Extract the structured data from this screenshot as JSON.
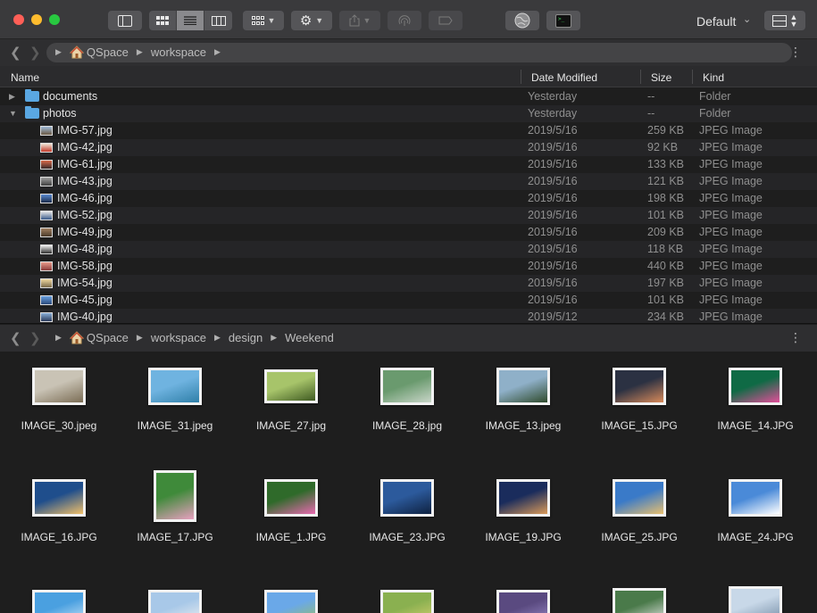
{
  "toolbar": {
    "profile": "Default"
  },
  "top_path": {
    "crumbs": [
      "QSpace",
      "workspace"
    ]
  },
  "columns": {
    "name": "Name",
    "date": "Date Modified",
    "size": "Size",
    "kind": "Kind"
  },
  "rows": [
    {
      "name": "documents",
      "date": "Yesterday",
      "size": "--",
      "kind": "Folder"
    },
    {
      "name": "photos",
      "date": "Yesterday",
      "size": "--",
      "kind": "Folder"
    },
    {
      "name": "IMG-57.jpg",
      "date": "2019/5/16",
      "size": "259 KB",
      "kind": "JPEG Image"
    },
    {
      "name": "IMG-42.jpg",
      "date": "2019/5/16",
      "size": "92 KB",
      "kind": "JPEG Image"
    },
    {
      "name": "IMG-61.jpg",
      "date": "2019/5/16",
      "size": "133 KB",
      "kind": "JPEG Image"
    },
    {
      "name": "IMG-43.jpg",
      "date": "2019/5/16",
      "size": "121 KB",
      "kind": "JPEG Image"
    },
    {
      "name": "IMG-46.jpg",
      "date": "2019/5/16",
      "size": "198 KB",
      "kind": "JPEG Image"
    },
    {
      "name": "IMG-52.jpg",
      "date": "2019/5/16",
      "size": "101 KB",
      "kind": "JPEG Image"
    },
    {
      "name": "IMG-49.jpg",
      "date": "2019/5/16",
      "size": "209 KB",
      "kind": "JPEG Image"
    },
    {
      "name": "IMG-48.jpg",
      "date": "2019/5/16",
      "size": "118 KB",
      "kind": "JPEG Image"
    },
    {
      "name": "IMG-58.jpg",
      "date": "2019/5/16",
      "size": "440 KB",
      "kind": "JPEG Image"
    },
    {
      "name": "IMG-54.jpg",
      "date": "2019/5/16",
      "size": "197 KB",
      "kind": "JPEG Image"
    },
    {
      "name": "IMG-45.jpg",
      "date": "2019/5/16",
      "size": "101 KB",
      "kind": "JPEG Image"
    },
    {
      "name": "IMG-40.jpg",
      "date": "2019/5/12",
      "size": "234 KB",
      "kind": "JPEG Image"
    }
  ],
  "bottom_path": {
    "crumbs": [
      "QSpace",
      "workspace",
      "design",
      "Weekend"
    ]
  },
  "tiles": [
    {
      "name": "IMAGE_30.jpeg",
      "colors": [
        "#c9c3b5",
        "#7b6d55"
      ]
    },
    {
      "name": "IMAGE_31.jpeg",
      "colors": [
        "#6fb3e0",
        "#2f7fa8"
      ]
    },
    {
      "name": "IMAGE_27.jpg",
      "colors": [
        "#a7c46a",
        "#3f5a22"
      ]
    },
    {
      "name": "IMAGE_28.jpg",
      "colors": [
        "#6a9a6e",
        "#c9d6c9"
      ]
    },
    {
      "name": "IMAGE_13.jpeg",
      "colors": [
        "#8fb0c8",
        "#2f4a2b"
      ]
    },
    {
      "name": "IMAGE_15.JPG",
      "colors": [
        "#2b3142",
        "#d88a5a"
      ]
    },
    {
      "name": "IMAGE_14.JPG",
      "colors": [
        "#0f6a45",
        "#e24f9a"
      ]
    },
    {
      "name": "IMAGE_16.JPG",
      "colors": [
        "#1f4e8c",
        "#f0c06a"
      ]
    },
    {
      "name": "IMAGE_17.JPG",
      "colors": [
        "#3f8a3a",
        "#e8a0c0"
      ]
    },
    {
      "name": "IMAGE_1.JPG",
      "colors": [
        "#2f6a2a",
        "#e86ab0"
      ]
    },
    {
      "name": "IMAGE_23.JPG",
      "colors": [
        "#2c5a9c",
        "#0e2140"
      ]
    },
    {
      "name": "IMAGE_19.JPG",
      "colors": [
        "#1a2c5c",
        "#d99a5a"
      ]
    },
    {
      "name": "IMAGE_25.JPG",
      "colors": [
        "#3a7ac8",
        "#e8c070"
      ]
    },
    {
      "name": "IMAGE_24.JPG",
      "colors": [
        "#4a8ad8",
        "#ffffff"
      ]
    },
    {
      "name": "",
      "colors": [
        "#4aa0e0",
        "#d0e8f8"
      ]
    },
    {
      "name": "",
      "colors": [
        "#a8c8e8",
        "#f0f0f0"
      ]
    },
    {
      "name": "",
      "colors": [
        "#6aa8e8",
        "#9ac060"
      ]
    },
    {
      "name": "",
      "colors": [
        "#8ab050",
        "#d8d070"
      ]
    },
    {
      "name": "",
      "colors": [
        "#5a4a80",
        "#9a8ac8"
      ]
    },
    {
      "name": "",
      "colors": [
        "#4a7a4a",
        "#e8e8e8"
      ]
    },
    {
      "name": "",
      "colors": [
        "#c8d8e8",
        "#7890a8"
      ]
    }
  ]
}
